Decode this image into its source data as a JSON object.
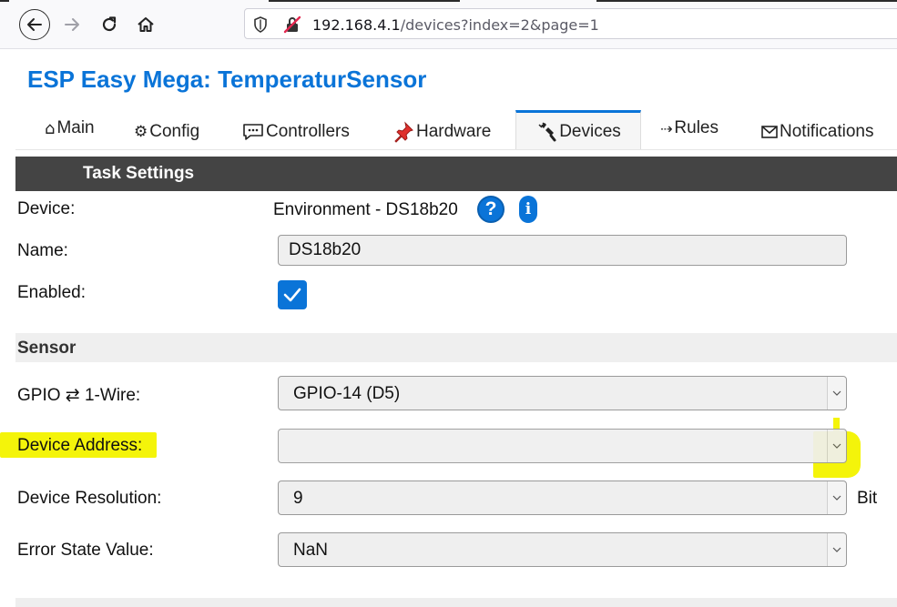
{
  "browser": {
    "url_host": "192.168.4.1",
    "url_path": "/devices?index=2&page=1"
  },
  "page": {
    "title": "ESP Easy Mega: TemperaturSensor"
  },
  "tabs": [
    {
      "label": "Main",
      "icon": "home-outline-icon"
    },
    {
      "label": "Config",
      "icon": "gear-icon"
    },
    {
      "label": "Controllers",
      "icon": "speech-bubble-icon"
    },
    {
      "label": "Hardware",
      "icon": "pushpin-icon"
    },
    {
      "label": "Devices",
      "icon": "plug-icon",
      "active": true
    },
    {
      "label": "Rules",
      "icon": "arrow-icon"
    },
    {
      "label": "Notifications",
      "icon": "envelope-icon"
    }
  ],
  "tab_glyphs": {
    "main": "⌂",
    "config": "⚙",
    "rules": "⇢"
  },
  "task_settings": {
    "header": "Task Settings",
    "device_label": "Device:",
    "device_value": "Environment - DS18b20",
    "help_glyph": "?",
    "info_glyph": "i",
    "name_label": "Name:",
    "name_value": "DS18b20",
    "enabled_label": "Enabled:",
    "enabled": true
  },
  "sensor": {
    "header": "Sensor",
    "gpio_label": "GPIO ⇄ 1-Wire:",
    "gpio_value": "GPIO-14 (D5)",
    "address_label": "Device Address:",
    "address_value": "",
    "resolution_label": "Device Resolution:",
    "resolution_value": "9",
    "resolution_unit": "Bit",
    "error_label": "Error State Value:",
    "error_value": "NaN"
  },
  "colors": {
    "accent": "#0a74d8",
    "highlight": "#f4f40a",
    "header_bg": "#444444"
  }
}
